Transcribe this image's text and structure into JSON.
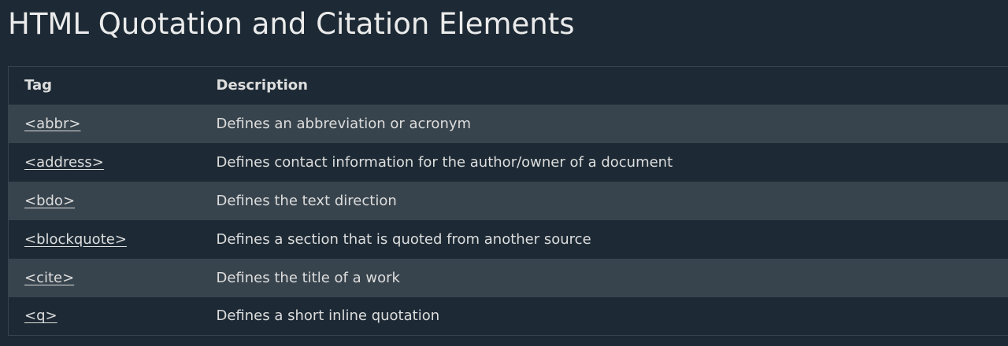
{
  "page": {
    "title": "HTML Quotation and Citation Elements"
  },
  "table": {
    "headers": {
      "tag": "Tag",
      "description": "Description"
    },
    "rows": [
      {
        "tag": "<abbr>",
        "description": "Defines an abbreviation or acronym"
      },
      {
        "tag": "<address>",
        "description": "Defines contact information for the author/owner of a document"
      },
      {
        "tag": "<bdo>",
        "description": "Defines the text direction"
      },
      {
        "tag": "<blockquote>",
        "description": "Defines a section that is quoted from another source"
      },
      {
        "tag": "<cite>",
        "description": "Defines the title of a work"
      },
      {
        "tag": "<q>",
        "description": "Defines a short inline quotation"
      }
    ]
  },
  "colors": {
    "background": "#1d2a35",
    "row_stripe": "#38444d",
    "text": "#dddddd",
    "heading": "#ebebeb"
  }
}
